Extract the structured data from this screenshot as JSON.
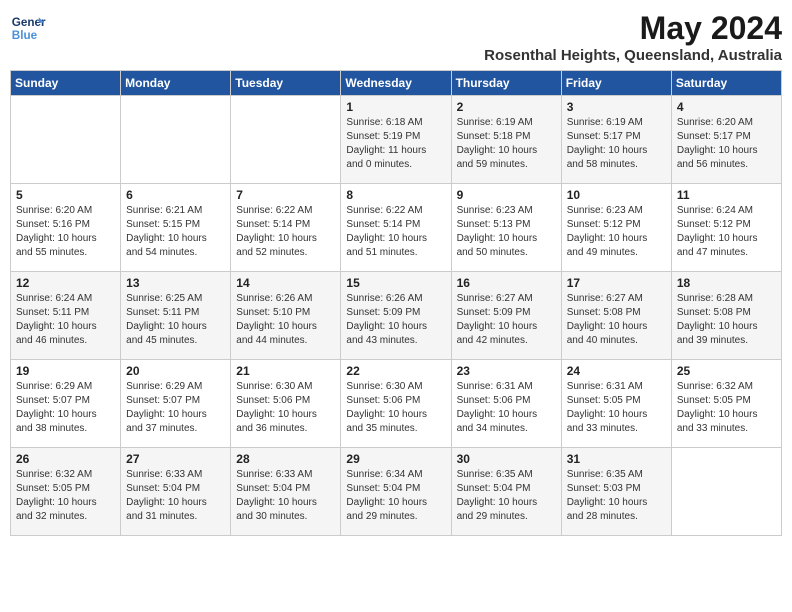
{
  "header": {
    "logo_line1": "General",
    "logo_line2": "Blue",
    "month": "May 2024",
    "location": "Rosenthal Heights, Queensland, Australia"
  },
  "weekdays": [
    "Sunday",
    "Monday",
    "Tuesday",
    "Wednesday",
    "Thursday",
    "Friday",
    "Saturday"
  ],
  "weeks": [
    [
      {
        "day": "",
        "info": ""
      },
      {
        "day": "",
        "info": ""
      },
      {
        "day": "",
        "info": ""
      },
      {
        "day": "1",
        "info": "Sunrise: 6:18 AM\nSunset: 5:19 PM\nDaylight: 11 hours\nand 0 minutes."
      },
      {
        "day": "2",
        "info": "Sunrise: 6:19 AM\nSunset: 5:18 PM\nDaylight: 10 hours\nand 59 minutes."
      },
      {
        "day": "3",
        "info": "Sunrise: 6:19 AM\nSunset: 5:17 PM\nDaylight: 10 hours\nand 58 minutes."
      },
      {
        "day": "4",
        "info": "Sunrise: 6:20 AM\nSunset: 5:17 PM\nDaylight: 10 hours\nand 56 minutes."
      }
    ],
    [
      {
        "day": "5",
        "info": "Sunrise: 6:20 AM\nSunset: 5:16 PM\nDaylight: 10 hours\nand 55 minutes."
      },
      {
        "day": "6",
        "info": "Sunrise: 6:21 AM\nSunset: 5:15 PM\nDaylight: 10 hours\nand 54 minutes."
      },
      {
        "day": "7",
        "info": "Sunrise: 6:22 AM\nSunset: 5:14 PM\nDaylight: 10 hours\nand 52 minutes."
      },
      {
        "day": "8",
        "info": "Sunrise: 6:22 AM\nSunset: 5:14 PM\nDaylight: 10 hours\nand 51 minutes."
      },
      {
        "day": "9",
        "info": "Sunrise: 6:23 AM\nSunset: 5:13 PM\nDaylight: 10 hours\nand 50 minutes."
      },
      {
        "day": "10",
        "info": "Sunrise: 6:23 AM\nSunset: 5:12 PM\nDaylight: 10 hours\nand 49 minutes."
      },
      {
        "day": "11",
        "info": "Sunrise: 6:24 AM\nSunset: 5:12 PM\nDaylight: 10 hours\nand 47 minutes."
      }
    ],
    [
      {
        "day": "12",
        "info": "Sunrise: 6:24 AM\nSunset: 5:11 PM\nDaylight: 10 hours\nand 46 minutes."
      },
      {
        "day": "13",
        "info": "Sunrise: 6:25 AM\nSunset: 5:11 PM\nDaylight: 10 hours\nand 45 minutes."
      },
      {
        "day": "14",
        "info": "Sunrise: 6:26 AM\nSunset: 5:10 PM\nDaylight: 10 hours\nand 44 minutes."
      },
      {
        "day": "15",
        "info": "Sunrise: 6:26 AM\nSunset: 5:09 PM\nDaylight: 10 hours\nand 43 minutes."
      },
      {
        "day": "16",
        "info": "Sunrise: 6:27 AM\nSunset: 5:09 PM\nDaylight: 10 hours\nand 42 minutes."
      },
      {
        "day": "17",
        "info": "Sunrise: 6:27 AM\nSunset: 5:08 PM\nDaylight: 10 hours\nand 40 minutes."
      },
      {
        "day": "18",
        "info": "Sunrise: 6:28 AM\nSunset: 5:08 PM\nDaylight: 10 hours\nand 39 minutes."
      }
    ],
    [
      {
        "day": "19",
        "info": "Sunrise: 6:29 AM\nSunset: 5:07 PM\nDaylight: 10 hours\nand 38 minutes."
      },
      {
        "day": "20",
        "info": "Sunrise: 6:29 AM\nSunset: 5:07 PM\nDaylight: 10 hours\nand 37 minutes."
      },
      {
        "day": "21",
        "info": "Sunrise: 6:30 AM\nSunset: 5:06 PM\nDaylight: 10 hours\nand 36 minutes."
      },
      {
        "day": "22",
        "info": "Sunrise: 6:30 AM\nSunset: 5:06 PM\nDaylight: 10 hours\nand 35 minutes."
      },
      {
        "day": "23",
        "info": "Sunrise: 6:31 AM\nSunset: 5:06 PM\nDaylight: 10 hours\nand 34 minutes."
      },
      {
        "day": "24",
        "info": "Sunrise: 6:31 AM\nSunset: 5:05 PM\nDaylight: 10 hours\nand 33 minutes."
      },
      {
        "day": "25",
        "info": "Sunrise: 6:32 AM\nSunset: 5:05 PM\nDaylight: 10 hours\nand 33 minutes."
      }
    ],
    [
      {
        "day": "26",
        "info": "Sunrise: 6:32 AM\nSunset: 5:05 PM\nDaylight: 10 hours\nand 32 minutes."
      },
      {
        "day": "27",
        "info": "Sunrise: 6:33 AM\nSunset: 5:04 PM\nDaylight: 10 hours\nand 31 minutes."
      },
      {
        "day": "28",
        "info": "Sunrise: 6:33 AM\nSunset: 5:04 PM\nDaylight: 10 hours\nand 30 minutes."
      },
      {
        "day": "29",
        "info": "Sunrise: 6:34 AM\nSunset: 5:04 PM\nDaylight: 10 hours\nand 29 minutes."
      },
      {
        "day": "30",
        "info": "Sunrise: 6:35 AM\nSunset: 5:04 PM\nDaylight: 10 hours\nand 29 minutes."
      },
      {
        "day": "31",
        "info": "Sunrise: 6:35 AM\nSunset: 5:03 PM\nDaylight: 10 hours\nand 28 minutes."
      },
      {
        "day": "",
        "info": ""
      }
    ]
  ]
}
